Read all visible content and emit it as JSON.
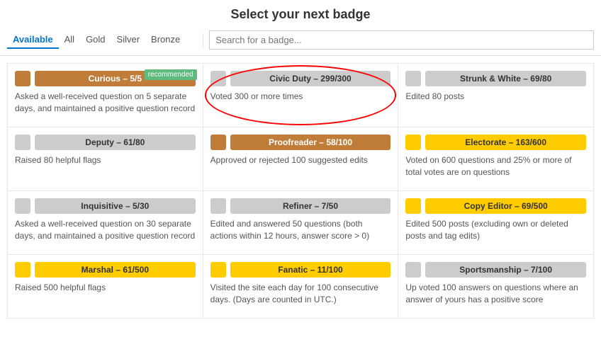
{
  "title": "Select your next badge",
  "filterTabs": [
    {
      "label": "Available",
      "active": true
    },
    {
      "label": "All",
      "active": false
    },
    {
      "label": "Gold",
      "active": false
    },
    {
      "label": "Silver",
      "active": false
    },
    {
      "label": "Bronze",
      "active": false
    }
  ],
  "searchPlaceholder": "Search for a badge...",
  "badges": [
    {
      "name": "Curious – 5/5",
      "iconType": "bronze-bar",
      "iconColor": "bronze",
      "desc": "Asked a well-received question on 5 separate days, and maintained a positive question record",
      "recommended": true
    },
    {
      "name": "Civic Duty – 299/300",
      "iconType": "gray-bar",
      "iconColor": "gray",
      "desc": "Voted 300 or more times",
      "recommended": false,
      "highlight": true
    },
    {
      "name": "Strunk & White – 69/80",
      "iconType": "gray-bar",
      "iconColor": "gray",
      "desc": "Edited 80 posts",
      "recommended": false
    },
    {
      "name": "Deputy – 61/80",
      "iconType": "gray-bar",
      "iconColor": "gray",
      "desc": "Raised 80 helpful flags",
      "recommended": false
    },
    {
      "name": "Proofreader – 58/100",
      "iconType": "bronze-bar",
      "iconColor": "bronze",
      "desc": "Approved or rejected 100 suggested edits",
      "recommended": false
    },
    {
      "name": "Electorate – 163/600",
      "iconType": "gold-bar",
      "iconColor": "gold",
      "desc": "Voted on 600 questions and 25% or more of total votes are on questions",
      "recommended": false
    },
    {
      "name": "Inquisitive – 5/30",
      "iconType": "gray-bar",
      "iconColor": "gray",
      "desc": "Asked a well-received question on 30 separate days, and maintained a positive question record",
      "recommended": false
    },
    {
      "name": "Refiner – 7/50",
      "iconType": "gray-bar",
      "iconColor": "gray",
      "desc": "Edited and answered 50 questions (both actions within 12 hours, answer score > 0)",
      "recommended": false
    },
    {
      "name": "Copy Editor – 69/500",
      "iconType": "gold-bar",
      "iconColor": "gold",
      "desc": "Edited 500 posts (excluding own or deleted posts and tag edits)",
      "recommended": false
    },
    {
      "name": "Marshal – 61/500",
      "iconType": "gold-bar",
      "iconColor": "gold",
      "desc": "Raised 500 helpful flags",
      "recommended": false
    },
    {
      "name": "Fanatic – 11/100",
      "iconType": "gold-bar",
      "iconColor": "gold",
      "desc": "Visited the site each day for 100 consecutive days. (Days are counted in UTC.)",
      "recommended": false
    },
    {
      "name": "Sportsmanship – 7/100",
      "iconType": "gray-bar",
      "iconColor": "gray",
      "desc": "Up voted 100 answers on questions where an answer of yours has a positive score",
      "recommended": false
    }
  ],
  "recommendedLabel": "recommended"
}
